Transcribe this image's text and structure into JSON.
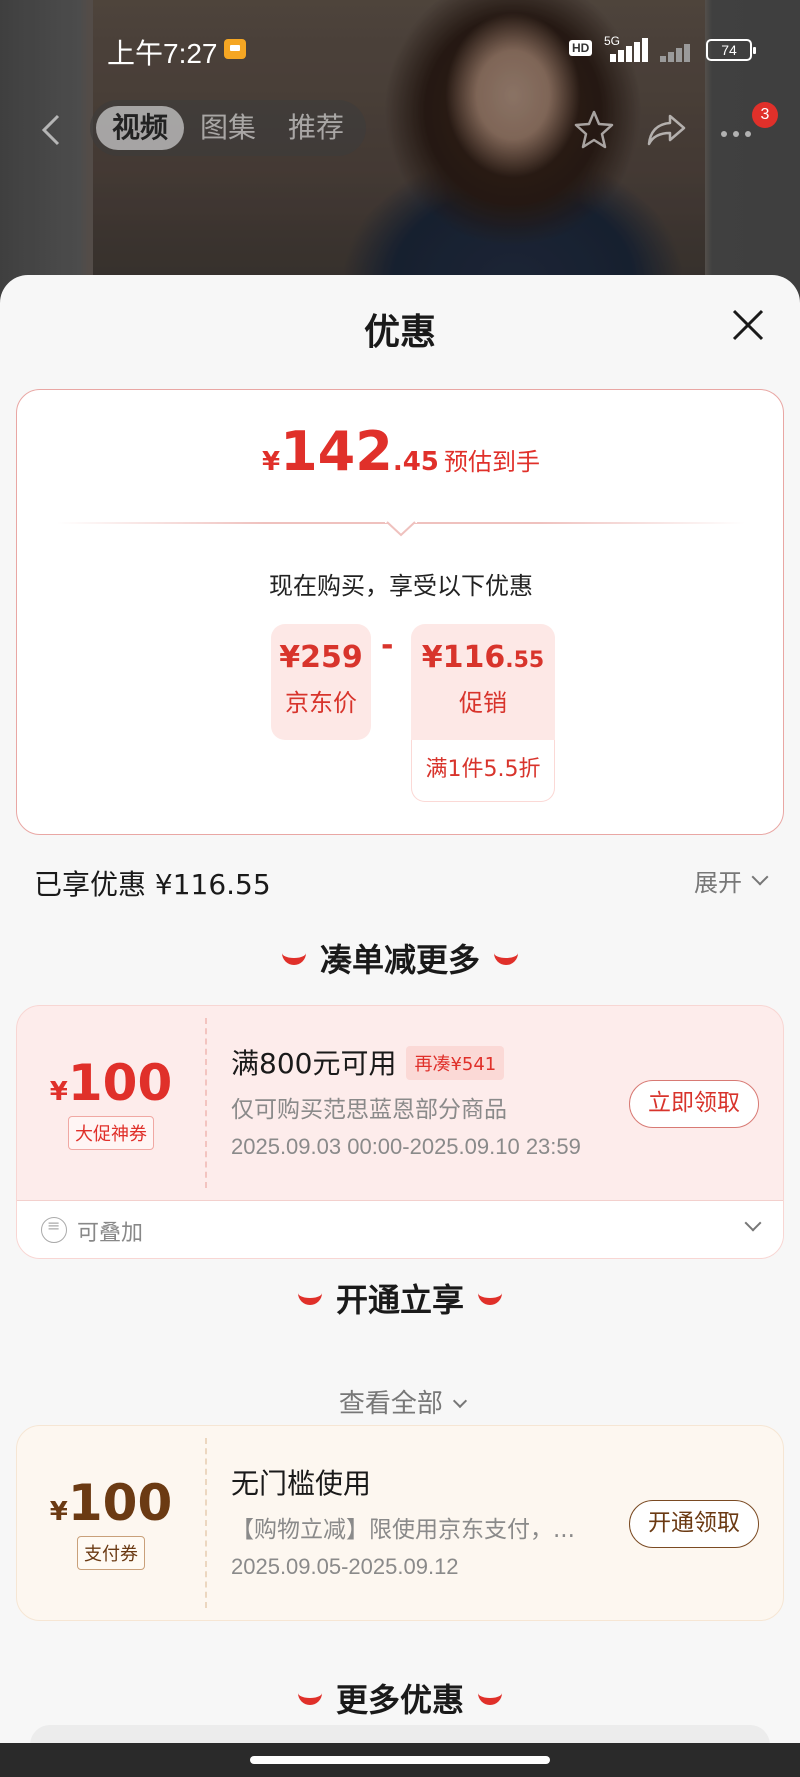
{
  "status_bar": {
    "time": "上午7:27",
    "network": "5G",
    "battery": "74"
  },
  "nav": {
    "tabs": [
      "视频",
      "图集",
      "推荐"
    ],
    "badge_count": "3"
  },
  "sheet": {
    "title": "优惠",
    "estimate": {
      "currency": "¥",
      "integer": "142",
      "decimal": ".45",
      "label": "预估到手"
    },
    "buy_note": "现在购买，享受以下优惠",
    "jd_price": {
      "amount": "¥259",
      "label": "京东价"
    },
    "minus": "-",
    "promo": {
      "amount_int": "¥116",
      "amount_dec": ".55",
      "label": "促销",
      "condition": "满1件5.5折"
    },
    "enjoyed": "已享优惠 ¥116.55",
    "expand": "展开"
  },
  "section1": {
    "title": "凑单减更多",
    "coupon": {
      "currency": "¥",
      "amount": "100",
      "tag": "大促神券",
      "title": "满800元可用",
      "extra": "再凑¥541",
      "desc": "仅可购买范思蓝恩部分商品",
      "date": "2025.09.03 00:00-2025.09.10 23:59",
      "button": "立即领取",
      "stackable": "可叠加"
    },
    "view_all": "查看全部"
  },
  "section2": {
    "title": "开通立享",
    "coupon": {
      "currency": "¥",
      "amount": "100",
      "tag": "支付券",
      "title": "无门槛使用",
      "desc": "【购物立减】限使用京东支付，...",
      "date": "2025.09.05-2025.09.12",
      "button": "开通领取"
    }
  },
  "section3": {
    "title": "更多优惠"
  },
  "colors": {
    "accent_red": "#e0302a",
    "promo_bg": "#fde8e6",
    "coupon1_bg": "#fdeceb",
    "coupon2_bg": "#fdf7f0",
    "brown_text": "#6b3a13"
  }
}
